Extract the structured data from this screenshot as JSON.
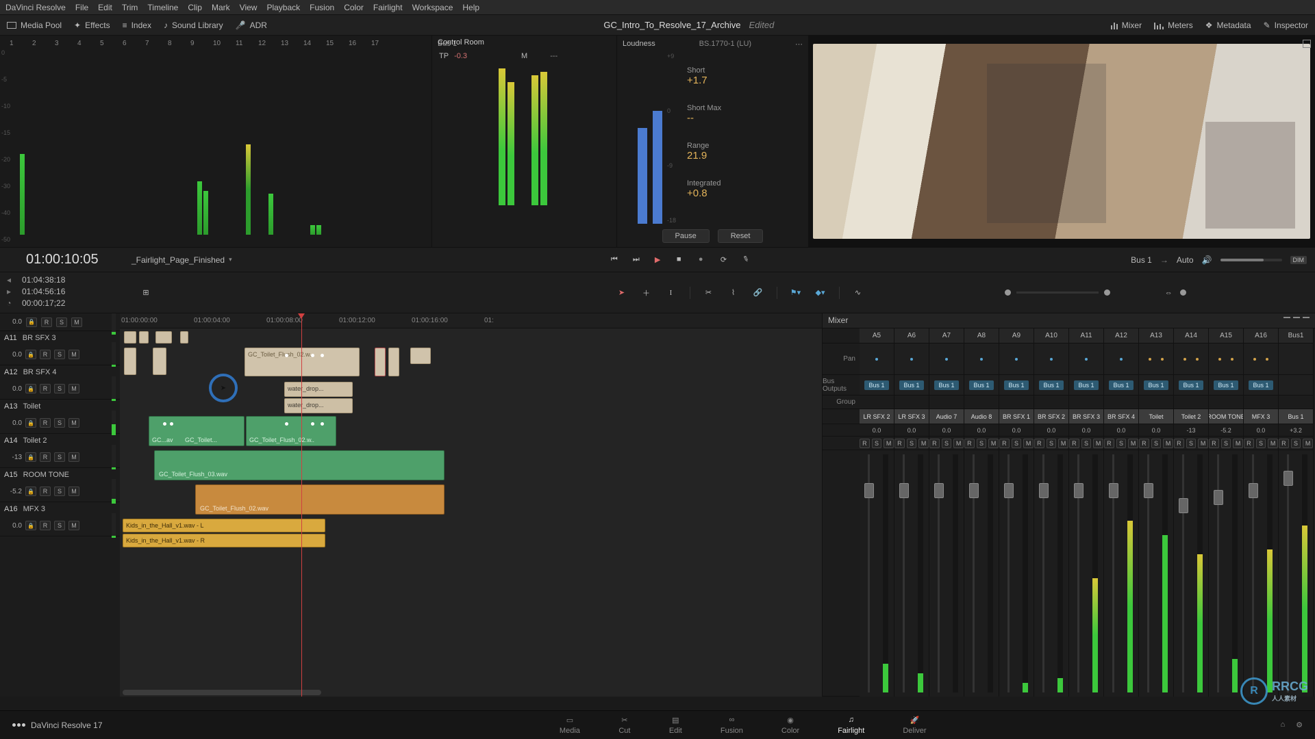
{
  "app": {
    "name": "DaVinci Resolve",
    "version_label": "DaVinci Resolve 17"
  },
  "menu": [
    "File",
    "Edit",
    "Trim",
    "Timeline",
    "Clip",
    "Mark",
    "View",
    "Playback",
    "Fusion",
    "Color",
    "Fairlight",
    "Workspace",
    "Help"
  ],
  "toolbar_left": [
    {
      "icon": "media-pool-icon",
      "label": "Media Pool"
    },
    {
      "icon": "effects-icon",
      "label": "Effects"
    },
    {
      "icon": "index-icon",
      "label": "Index"
    },
    {
      "icon": "sound-library-icon",
      "label": "Sound Library"
    },
    {
      "icon": "adr-icon",
      "label": "ADR"
    }
  ],
  "toolbar_right": [
    {
      "icon": "mixer-icon",
      "label": "Mixer"
    },
    {
      "icon": "meters-icon",
      "label": "Meters"
    },
    {
      "icon": "metadata-icon",
      "label": "Metadata"
    },
    {
      "icon": "inspector-icon",
      "label": "Inspector"
    }
  ],
  "project": {
    "title": "GC_Intro_To_Resolve_17_Archive",
    "status": "Edited"
  },
  "meters_panel": {
    "channel_numbers": [
      "1",
      "2",
      "3",
      "4",
      "5",
      "6",
      "7",
      "8",
      "9",
      "10",
      "11",
      "12",
      "13",
      "14",
      "15",
      "16",
      "17"
    ],
    "db_scale": [
      "0",
      "-5",
      "-10",
      "-15",
      "-20",
      "-30",
      "-40",
      "-50"
    ]
  },
  "bus_panel": {
    "title": "Control Room",
    "bus_label": "Bus 1",
    "tp_label": "TP",
    "tp_value": "-0.3",
    "m_label": "M",
    "m_value": "---"
  },
  "loudness": {
    "title": "Loudness",
    "standard": "BS.1770-1 (LU)",
    "scale": [
      "+9",
      "0",
      "-9",
      "-18"
    ],
    "stats": [
      {
        "label": "Short",
        "value": "+1.7"
      },
      {
        "label": "Short Max",
        "value": "--"
      },
      {
        "label": "Range",
        "value": "21.9"
      },
      {
        "label": "Integrated",
        "value": "+0.8"
      }
    ],
    "pause": "Pause",
    "reset": "Reset"
  },
  "transport": {
    "big_tc": "01:00:10:05",
    "timeline_name": "_Fairlight_Page_Finished",
    "tc_in": "01:04:38:18",
    "tc_out": "01:04:56:16",
    "tc_dur": "00:00:17;22",
    "monitor_source": "Bus 1",
    "monitor_mode": "Auto",
    "dim_label": "DIM"
  },
  "ruler_ticks": [
    {
      "label": "01:00:00:00",
      "pos": 2
    },
    {
      "label": "01:00:04:00",
      "pos": 108
    },
    {
      "label": "01:00:08:00",
      "pos": 214
    },
    {
      "label": "01:00:12:00",
      "pos": 320
    },
    {
      "label": "01:00:16:00",
      "pos": 426
    },
    {
      "label": "01:",
      "pos": 532
    }
  ],
  "tracks": [
    {
      "id": "",
      "name": "",
      "db": "0.0",
      "short": true
    },
    {
      "id": "A11",
      "name": "BR SFX 3",
      "db": "0.0"
    },
    {
      "id": "A12",
      "name": "BR SFX 4",
      "db": "0.0"
    },
    {
      "id": "A13",
      "name": "Toilet",
      "db": "0.0"
    },
    {
      "id": "A14",
      "name": "Toilet 2",
      "db": "-13"
    },
    {
      "id": "A15",
      "name": "ROOM TONE",
      "db": "-5.2"
    },
    {
      "id": "A16",
      "name": "MFX 3",
      "db": "0.0"
    }
  ],
  "track_btns": [
    "R",
    "S",
    "M"
  ],
  "clips": {
    "flush02": "GC_Toilet_Flush_02.wav",
    "flush02s": "GC_Toilet_Flush_02.w..",
    "flush03": "GC_Toilet_Flush_03.wav",
    "toilet": "GC_Toilet...",
    "gcav": "GC...av",
    "water": "water_drop...",
    "hall_l": "Kids_in_the_Hall_v1.wav - L",
    "hall_r": "Kids_in_the_Hall_v1.wav - R"
  },
  "mixer": {
    "title": "Mixer",
    "row_labels": {
      "pan": "Pan",
      "bus": "Bus Outputs",
      "group": "Group"
    },
    "bus_tag": "Bus 1",
    "strips": [
      {
        "id": "A5",
        "name": "LR SFX 2",
        "db": "0.0",
        "meter": 12,
        "cap": 48,
        "pan": "c"
      },
      {
        "id": "A6",
        "name": "LR SFX 3",
        "db": "0.0",
        "meter": 8,
        "cap": 48,
        "pan": "c"
      },
      {
        "id": "A7",
        "name": "Audio 7",
        "db": "0.0",
        "meter": 0,
        "cap": 48,
        "pan": "c"
      },
      {
        "id": "A8",
        "name": "Audio 8",
        "db": "0.0",
        "meter": 0,
        "cap": 48,
        "pan": "c"
      },
      {
        "id": "A9",
        "name": "BR SFX 1",
        "db": "0.0",
        "meter": 4,
        "cap": 48,
        "pan": "c"
      },
      {
        "id": "A10",
        "name": "BR SFX 2",
        "db": "0.0",
        "meter": 6,
        "cap": 48,
        "pan": "c"
      },
      {
        "id": "A11",
        "name": "BR SFX 3",
        "db": "0.0",
        "meter": 48,
        "cap": 48,
        "pan": "c",
        "y": true
      },
      {
        "id": "A12",
        "name": "BR SFX 4",
        "db": "0.0",
        "meter": 72,
        "cap": 48,
        "pan": "c",
        "y": true
      },
      {
        "id": "A13",
        "name": "Toilet",
        "db": "0.0",
        "meter": 66,
        "cap": 48,
        "pan": "lr"
      },
      {
        "id": "A14",
        "name": "Toilet 2",
        "db": "-13",
        "meter": 58,
        "cap": 70,
        "pan": "lr",
        "y": true
      },
      {
        "id": "A15",
        "name": "ROOM TONE",
        "db": "-5.2",
        "meter": 14,
        "cap": 58,
        "pan": "lr"
      },
      {
        "id": "A16",
        "name": "MFX 3",
        "db": "0.0",
        "meter": 60,
        "cap": 48,
        "pan": "lr",
        "y": true
      },
      {
        "id": "Bus1",
        "name": "Bus 1",
        "db": "+3.2",
        "meter": 70,
        "cap": 30,
        "pan": "",
        "y": true,
        "is_bus": true
      }
    ],
    "strip_btns": [
      "R",
      "S",
      "M"
    ]
  },
  "pages": [
    "Media",
    "Cut",
    "Edit",
    "Fusion",
    "Color",
    "Fairlight",
    "Deliver"
  ],
  "active_page": "Fairlight",
  "watermark": {
    "main": "RRCG",
    "sub": "人人素材"
  }
}
